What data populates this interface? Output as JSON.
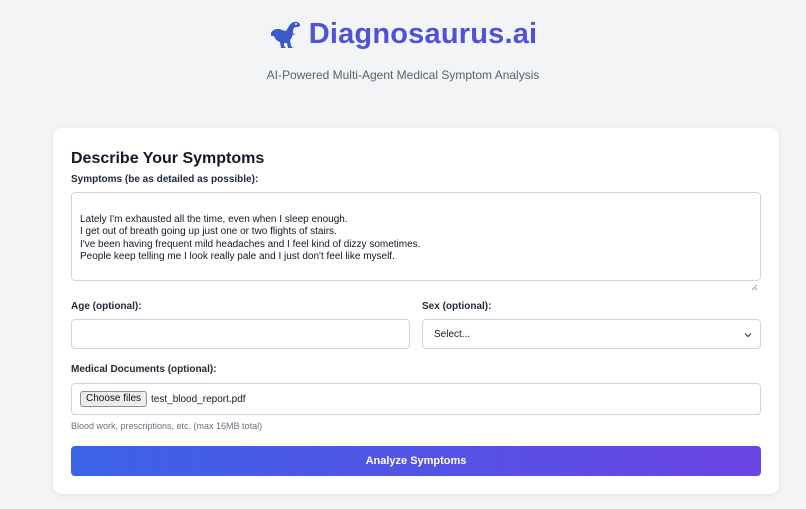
{
  "header": {
    "title": "Diagnosaurus.ai",
    "tagline": "AI-Powered Multi-Agent Medical Symptom Analysis",
    "logo_icon": "dinosaur-icon",
    "brand_color": "#4f52d6"
  },
  "form": {
    "title": "Describe Your Symptoms",
    "symptoms_label": "Symptoms (be as detailed as possible):",
    "symptoms_value": "Lately I'm exhausted all the time, even when I sleep enough.\nI get out of breath going up just one or two flights of stairs.\nI've been having frequent mild headaches and I feel kind of dizzy sometimes.\nPeople keep telling me I look really pale and I just don't feel like myself.",
    "age_label": "Age (optional):",
    "age_value": "",
    "sex_label": "Sex (optional):",
    "sex_selected": "Select...",
    "documents_label": "Medical Documents (optional):",
    "choose_files_label": "Choose files",
    "file_name": "test_blood_report.pdf",
    "documents_hint": "Blood work, prescriptions, etc. (max 16MB total)",
    "submit_label": "Analyze Symptoms",
    "button_gradient": [
      "#3b63e6",
      "#6b45e0"
    ]
  }
}
